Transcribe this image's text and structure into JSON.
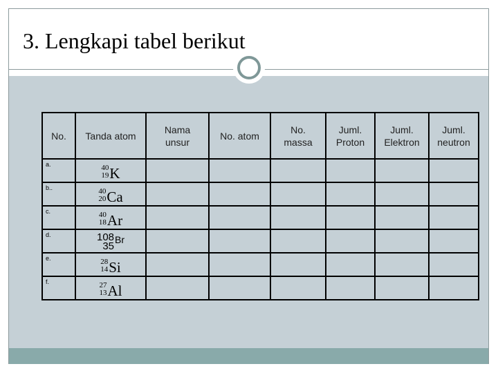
{
  "slide": {
    "title": "3. Lengkapi tabel berikut"
  },
  "table": {
    "headers": [
      {
        "line1": "No.",
        "line2": ""
      },
      {
        "line1": "Tanda atom",
        "line2": ""
      },
      {
        "line1": "Nama",
        "line2": "unsur"
      },
      {
        "line1": "No. atom",
        "line2": ""
      },
      {
        "line1": "No.",
        "line2": "massa"
      },
      {
        "line1": "Juml.",
        "line2": "Proton"
      },
      {
        "line1": "Juml.",
        "line2": "Elektron"
      },
      {
        "line1": "Juml.",
        "line2": "neutron"
      }
    ],
    "rows": [
      {
        "label": "a.",
        "mass": "40",
        "atomic": "19",
        "symbol": "K",
        "style": "serif"
      },
      {
        "label": "b..",
        "mass": "40",
        "atomic": "20",
        "symbol": "Ca",
        "style": "serif"
      },
      {
        "label": "c.",
        "mass": "40",
        "atomic": "18",
        "symbol": "Ar",
        "style": "serif"
      },
      {
        "label": "d.",
        "mass": "108",
        "atomic": "35",
        "symbol": "Br",
        "style": "sans"
      },
      {
        "label": "e.",
        "mass": "28",
        "atomic": "14",
        "symbol": "Si",
        "style": "serif"
      },
      {
        "label": "f.",
        "mass": "27",
        "atomic": "13",
        "symbol": "Al",
        "style": "serif"
      }
    ]
  },
  "colors": {
    "body_bg": "#c5d0d6",
    "footer_bar": "#89aaaa",
    "frame": "#8c9a9c",
    "ring": "#7f9898"
  }
}
